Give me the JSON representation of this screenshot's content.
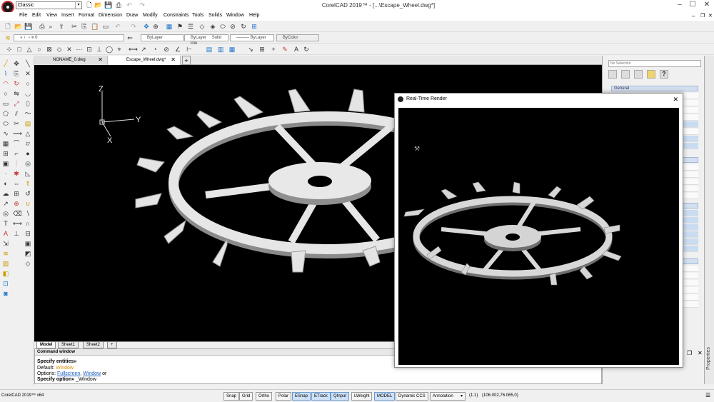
{
  "app": {
    "workspace": "Classic",
    "title": "CorelCAD 2019™ - [...\\Escape_Wheel.dwg*]"
  },
  "menu": [
    "File",
    "Edit",
    "View",
    "Insert",
    "Format",
    "Dimension",
    "Draw",
    "Modify",
    "Constraints",
    "Tools",
    "Solids",
    "Window",
    "Help"
  ],
  "layer_toolbar": {
    "layer": "0",
    "color": "ByLayer",
    "linestyle": "ByLayer",
    "linestyle_name": "Solid line",
    "lineweight": "ByLayer",
    "printstyle": "ByColor"
  },
  "doc_tabs": [
    "NONAME_0.dwg",
    "Escape_Wheel.dwg*"
  ],
  "sheet_tabs": [
    "Model",
    "Sheet1",
    "Sheet2"
  ],
  "axes": {
    "z": "Z",
    "y": "Y",
    "x": "X"
  },
  "command": {
    "header": "Command window",
    "line1": "Specify entities»",
    "line2_label": "Default:",
    "line2_value": "Window",
    "line3_label": "Options:",
    "opt1": "Fullscreen",
    "opt_sep": ",",
    "opt2": "Window",
    "opt_or": "or",
    "line4_label": "Specify option»",
    "line4_value": "_Window"
  },
  "properties": {
    "selection": "No Selection",
    "section": "General",
    "tab_label": "Properties"
  },
  "render_window": {
    "title": "Real-Time Render"
  },
  "status": {
    "app_version": "CorelCAD 2019™ x64",
    "buttons": [
      "Snap",
      "Grid",
      "Ortho",
      "Polar",
      "ESnap",
      "ETrack",
      "QInput",
      "LWeight",
      "MODEL",
      "Dynamic CCS"
    ],
    "active": [
      "ESnap",
      "ETrack",
      "QInput",
      "MODEL"
    ],
    "annotation": "Annotation",
    "scale": "(1:1)",
    "coords": "(106.002,76.065,0)"
  }
}
